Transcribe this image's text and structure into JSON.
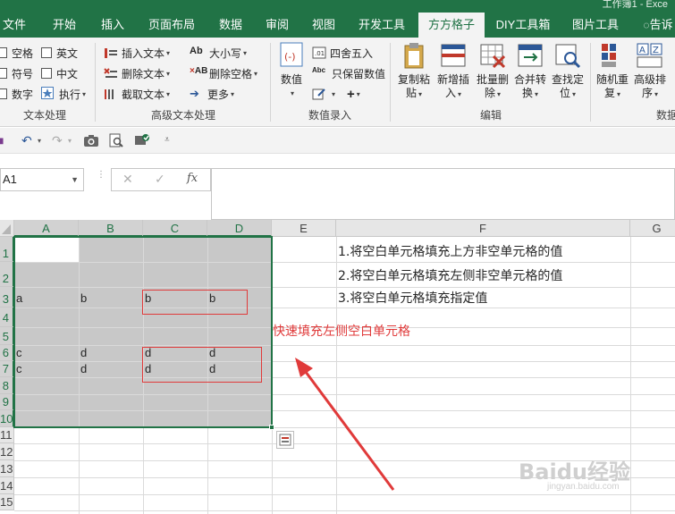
{
  "window": {
    "title_fragment": "工作簿1 - Exce"
  },
  "tabs": [
    {
      "label": "文件",
      "active": false
    },
    {
      "label": "开始",
      "active": false
    },
    {
      "label": "插入",
      "active": false
    },
    {
      "label": "页面布局",
      "active": false
    },
    {
      "label": "数据",
      "active": false
    },
    {
      "label": "审阅",
      "active": false
    },
    {
      "label": "视图",
      "active": false
    },
    {
      "label": "开发工具",
      "active": false
    },
    {
      "label": "方方格子",
      "active": true
    },
    {
      "label": "DIY工具箱",
      "active": false
    },
    {
      "label": "图片工具",
      "active": false
    },
    {
      "label": "告诉",
      "active": false
    }
  ],
  "ribbon": {
    "text_group": {
      "label": "文本处理",
      "checkboxes": [
        "空格",
        "英文",
        "符号",
        "中文",
        "数字"
      ],
      "execute_label": "执行"
    },
    "adv_text_group": {
      "label": "高级文本处理",
      "insert_text": "插入文本",
      "delete_text": "删除文本",
      "extract_text": "截取文本",
      "case": "大小写",
      "delete_spaces": "删除空格",
      "more": "更多"
    },
    "numeric_group": {
      "label": "数值录入",
      "numeric": "数值",
      "round": "四舍五入",
      "keep_numeric": "只保留数值"
    },
    "edit_group": {
      "label": "编辑",
      "buttons": [
        {
          "line1": "复制粘",
          "line2": "贴"
        },
        {
          "line1": "新增插",
          "line2": "入"
        },
        {
          "line1": "批量删",
          "line2": "除"
        },
        {
          "line1": "合并转",
          "line2": "换"
        },
        {
          "line1": "查找定",
          "line2": "位"
        }
      ]
    },
    "data_group": {
      "label": "数据",
      "buttons": [
        {
          "line1": "随机重",
          "line2": "复"
        },
        {
          "line1": "高级排",
          "line2": "序"
        }
      ]
    }
  },
  "formula_bar": {
    "name_box": "A1",
    "fx": "fx",
    "formula": ""
  },
  "sheet": {
    "columns": [
      "A",
      "B",
      "C",
      "D",
      "E",
      "F",
      "G"
    ],
    "rows": [
      "1",
      "2",
      "3",
      "4",
      "5",
      "6",
      "7",
      "8",
      "9",
      "10",
      "11",
      "12",
      "13",
      "14",
      "15"
    ],
    "cells": {
      "A3": "a",
      "B3": "b",
      "C3": "b",
      "D3": "b",
      "A6": "c",
      "B6": "d",
      "C6": "d",
      "D6": "d",
      "A7": "c",
      "B7": "d",
      "C7": "d",
      "D7": "d"
    },
    "notes": [
      "1.将空白单元格填充上方非空单元格的值",
      "2.将空白单元格填充左侧非空单元格的值",
      "3.将空白单元格填充指定值"
    ],
    "annotation": "快速填充左侧空白单元格",
    "colors": {
      "selection": "#c8c8c8",
      "accent": "#217346",
      "annotation": "#e03a3a"
    }
  },
  "watermark": {
    "brand": "Baidu经验",
    "url": "jingyan.baidu.com"
  }
}
